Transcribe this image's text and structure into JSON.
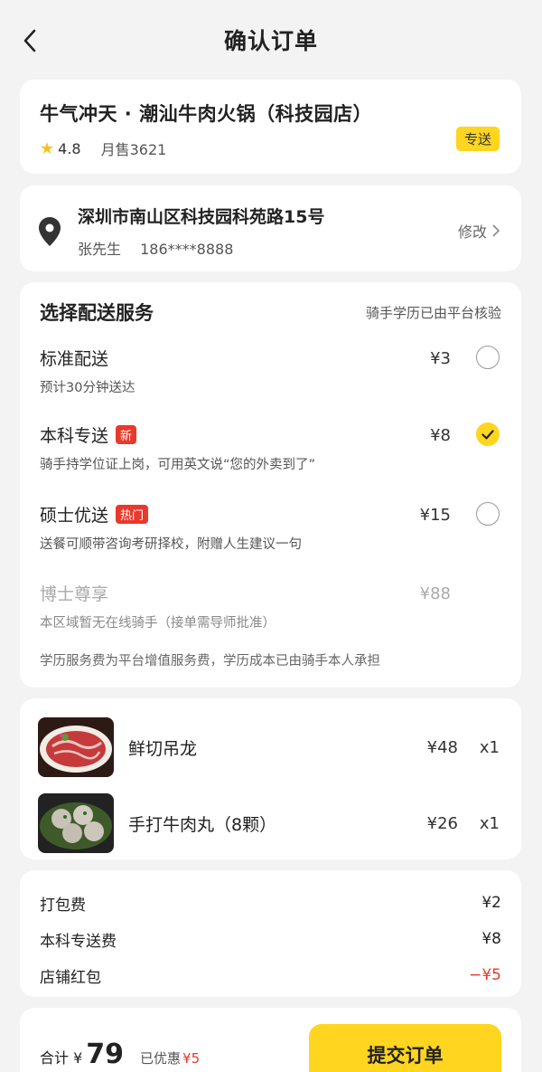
{
  "header": {
    "title": "确认订单"
  },
  "store": {
    "name": "牛气冲天 · 潮汕牛肉火锅（科技园店）",
    "rating": "4.8",
    "sales": "月售3621",
    "mode_badge": "专送"
  },
  "address": {
    "line": "深圳市南山区科技园科苑路15号",
    "name": "张先生",
    "phone": "186****8888",
    "edit_label": "修改"
  },
  "delivery": {
    "title": "选择配送服务",
    "note": "骑手学历已由平台核验",
    "options": [
      {
        "name": "标准配送",
        "tag": "",
        "desc": "预计30分钟送达",
        "price": "¥3",
        "selected": false,
        "disabled": false
      },
      {
        "name": "本科专送",
        "tag": "新",
        "desc": "骑手持学位证上岗，可用英文说“您的外卖到了”",
        "price": "¥8",
        "selected": true,
        "disabled": false
      },
      {
        "name": "硕士优送",
        "tag": "热门",
        "desc": "送餐可顺带咨询考研择校，附赠人生建议一句",
        "price": "¥15",
        "selected": false,
        "disabled": false
      },
      {
        "name": "博士尊享",
        "tag": "",
        "desc": "本区域暂无在线骑手（接单需导师批准）",
        "price": "¥88",
        "selected": false,
        "disabled": true
      }
    ],
    "footer": "学历服务费为平台增值服务费，学历成本已由骑手本人承担"
  },
  "items": [
    {
      "name": "鲜切吊龙",
      "price": "¥48",
      "qty": "x1"
    },
    {
      "name": "手打牛肉丸（8颗）",
      "price": "¥26",
      "qty": "x1"
    }
  ],
  "fees": [
    {
      "label": "打包费",
      "value": "¥2",
      "negative": false
    },
    {
      "label": "本科专送费",
      "value": "¥8",
      "negative": false
    },
    {
      "label": "店铺红包",
      "value": "−¥5",
      "negative": true
    }
  ],
  "bottom": {
    "total_label": "合计 ¥",
    "total_value": "79",
    "saved_label": "已优惠",
    "saved_value": "¥5",
    "submit_label": "提交订单"
  },
  "colors": {
    "accent": "#ffd51f",
    "red": "#e8392c",
    "background": "#f3f3f3"
  }
}
